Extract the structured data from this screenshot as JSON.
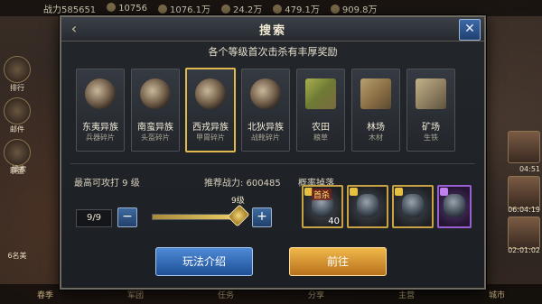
{
  "hud": {
    "power": "战力585651",
    "res1": "10756",
    "res2": "1076.1万",
    "res3": "24.2万",
    "res4": "479.1万",
    "res5": "909.8万",
    "left_buttons": [
      "排行",
      "邮件",
      "联盟",
      "搜索"
    ],
    "left_status": "6名美",
    "right_times": [
      "04:51",
      "06:04:19",
      "02:01:02"
    ],
    "bottom_tabs": [
      "春季",
      "军团",
      "任务",
      "分享",
      "主营",
      "城市"
    ]
  },
  "dialog": {
    "title": "搜索",
    "subtitle": "各个等级首次击杀有丰厚奖励",
    "tiles": [
      {
        "name": "东夷异族",
        "sub": "兵器碎片",
        "kind": "troop",
        "selected": false
      },
      {
        "name": "南蛮异族",
        "sub": "头盔碎片",
        "kind": "troop",
        "selected": false
      },
      {
        "name": "西戎异族",
        "sub": "甲胄碎片",
        "kind": "troop",
        "selected": true
      },
      {
        "name": "北狄异族",
        "sub": "战靴碎片",
        "kind": "troop",
        "selected": false
      },
      {
        "name": "农田",
        "sub": "粮草",
        "kind": "land",
        "selected": false
      },
      {
        "name": "林场",
        "sub": "木材",
        "kind": "wood",
        "selected": false
      },
      {
        "name": "矿场",
        "sub": "生铁",
        "kind": "mine",
        "selected": false
      }
    ],
    "max_attack": "最高可攻打 9 级",
    "recommend": "推荐战力:  600485",
    "drop_label": "概率掉落",
    "level_value": "9/9",
    "slider_label": "9级",
    "slider_level": 1.0,
    "drops": [
      {
        "tag": "首杀",
        "count": "40",
        "rarity": "gold"
      },
      {
        "tag": "",
        "count": "",
        "rarity": "gold"
      },
      {
        "tag": "",
        "count": "",
        "rarity": "gold"
      },
      {
        "tag": "",
        "count": "",
        "rarity": "purple"
      }
    ],
    "btn_intro": "玩法介绍",
    "btn_go": "前往"
  }
}
